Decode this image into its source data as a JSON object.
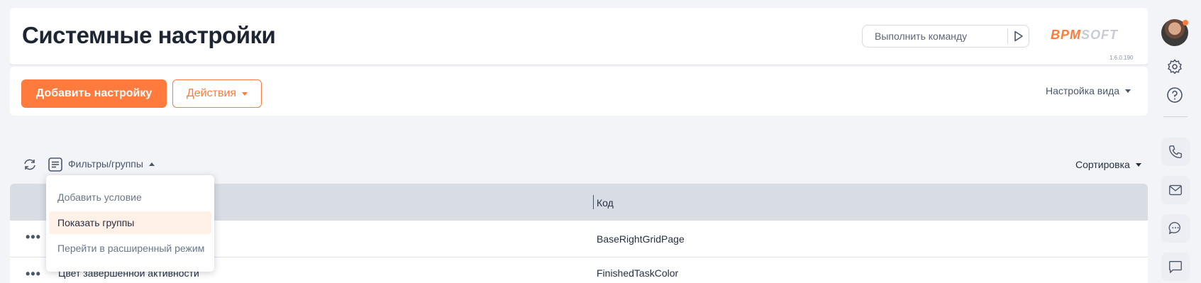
{
  "header": {
    "title": "Системные настройки",
    "command_placeholder": "Выполнить команду",
    "logo_primary": "BPM",
    "logo_secondary": "SOFT",
    "version": "1.6.0.190"
  },
  "toolbar": {
    "add_label": "Добавить настройку",
    "actions_label": "Действия",
    "view_settings_label": "Настройка вида"
  },
  "filters": {
    "toggle_label": "Фильтры/группы",
    "sort_label": "Сортировка",
    "menu": [
      {
        "label": "Добавить условие"
      },
      {
        "label": "Показать группы"
      },
      {
        "label": "Перейти в расширенный режим"
      }
    ]
  },
  "grid": {
    "columns": [
      "",
      "Код"
    ],
    "rows": [
      {
        "name": "",
        "code": "BaseRightGridPage"
      },
      {
        "name": "Цвет завершенной активности",
        "code": "FinishedTaskColor"
      }
    ]
  },
  "colors": {
    "accent": "#ff7b3d",
    "header_bg": "#d8dce3",
    "page_bg": "#f3f4f8"
  },
  "sidebar": {
    "icons": [
      "settings-icon",
      "help-icon",
      "phone-icon",
      "mail-icon",
      "chat-icon",
      "message-icon"
    ]
  }
}
